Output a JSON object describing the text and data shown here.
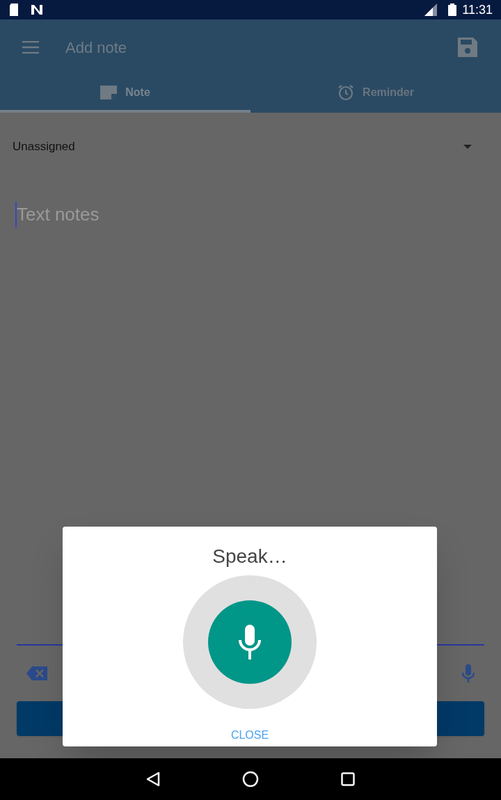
{
  "status_bar": {
    "time": "11:31"
  },
  "app_bar": {
    "title": "Add note"
  },
  "tabs": [
    {
      "label": "Note",
      "selected": true
    },
    {
      "label": "Reminder",
      "selected": false
    }
  ],
  "category": {
    "value": "Unassigned"
  },
  "note": {
    "placeholder": "Text notes"
  },
  "dialog": {
    "title": "Speak…",
    "button": "CLOSE"
  }
}
